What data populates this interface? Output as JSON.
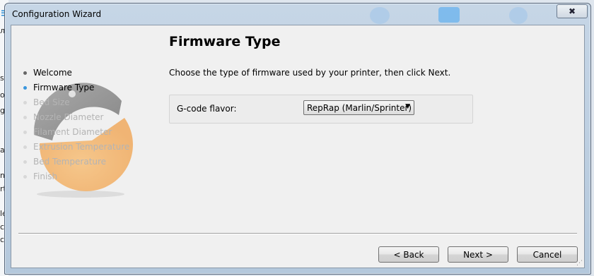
{
  "background_app": {
    "fragments": [
      "≡",
      "л",
      "s",
      "ov",
      "gs",
      "ar",
      "no",
      "rt",
      "le",
      "ce",
      "c"
    ]
  },
  "window": {
    "title": "Configuration Wizard",
    "close_glyph": "✖"
  },
  "page": {
    "title": "Firmware Type",
    "instructions": "Choose the type of firmware used by your printer, then click Next."
  },
  "steps": [
    {
      "label": "Welcome",
      "state": "done"
    },
    {
      "label": "Firmware Type",
      "state": "active"
    },
    {
      "label": "Bed Size",
      "state": "pending"
    },
    {
      "label": "Nozzle Diameter",
      "state": "pending"
    },
    {
      "label": "Filament Diameter",
      "state": "pending"
    },
    {
      "label": "Extrusion Temperature",
      "state": "pending"
    },
    {
      "label": "Bed Temperature",
      "state": "pending"
    },
    {
      "label": "Finish",
      "state": "pending"
    }
  ],
  "settings": {
    "gcode_flavor_label": "G-code flavor:",
    "gcode_flavor_value": "RepRap (Marlin/Sprinter)"
  },
  "buttons": {
    "back": "< Back",
    "next": "Next >",
    "cancel": "Cancel"
  },
  "colors": {
    "active_step_dot": "#3a96dd",
    "logo_orange": "#f0a04a",
    "logo_gray": "#8a8a8a"
  },
  "icons": {
    "steps_logo": "slic3r-logo-icon",
    "dropdown": "chevron-down-icon",
    "close": "close-icon"
  }
}
